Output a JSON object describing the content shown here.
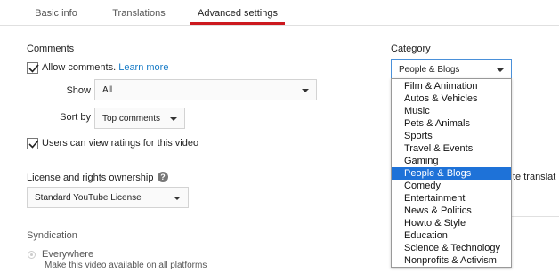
{
  "tabs": [
    {
      "label": "Basic info"
    },
    {
      "label": "Translations"
    },
    {
      "label": "Advanced settings"
    }
  ],
  "comments": {
    "title": "Comments",
    "allow_label": "Allow comments.",
    "learn_more": "Learn more",
    "show_label": "Show",
    "show_value": "All",
    "sort_label": "Sort by",
    "sort_value": "Top comments",
    "ratings_label": "Users can view ratings for this video"
  },
  "license": {
    "title": "License and rights ownership",
    "help": "?",
    "value": "Standard YouTube License"
  },
  "syndication": {
    "title": "Syndication",
    "option": "Everywhere",
    "description": "Make this video available on all platforms"
  },
  "category": {
    "title": "Category",
    "selected": "People & Blogs",
    "options": [
      "Film & Animation",
      "Autos & Vehicles",
      "Music",
      "Pets & Animals",
      "Sports",
      "Travel & Events",
      "Gaming",
      "People & Blogs",
      "Comedy",
      "Entertainment",
      "News & Politics",
      "Howto & Style",
      "Education",
      "Science & Technology",
      "Nonprofits & Activism"
    ]
  },
  "behind": {
    "translat": "te translat"
  },
  "colors": {
    "accent_red": "#cc181e",
    "link_blue": "#167ac6",
    "selected_blue": "#1e72d8"
  }
}
